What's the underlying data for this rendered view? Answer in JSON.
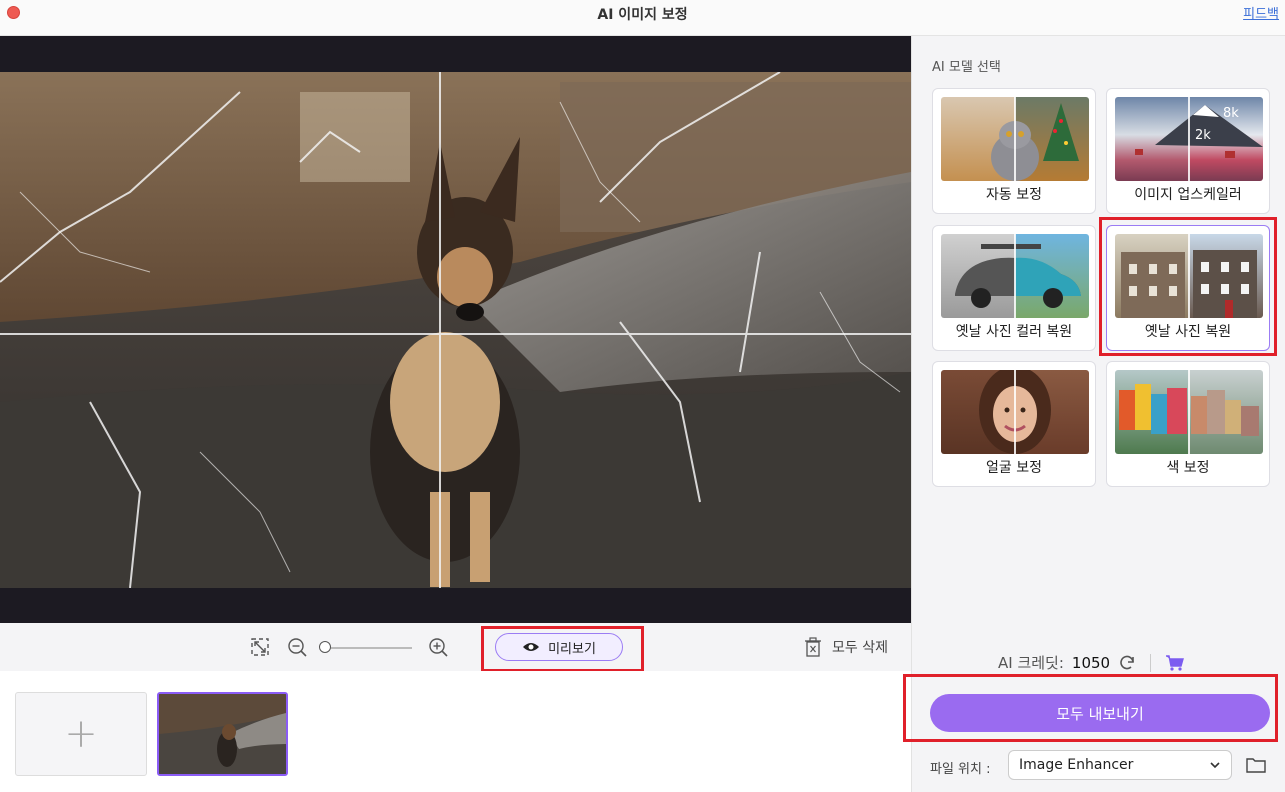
{
  "window": {
    "title": "AI 이미지 보정",
    "feedback_link": "피드백"
  },
  "toolbar": {
    "fit_icon": "fit-screen-icon",
    "zoom_out_icon": "zoom-out-icon",
    "zoom_in_icon": "zoom-in-icon",
    "zoom_level_fraction": 0.0,
    "preview_label": "미리보기",
    "delete_all_label": "모두 삭제"
  },
  "thumbnails": {
    "add_icon": "plus-icon",
    "items": [
      {
        "selected": true
      }
    ]
  },
  "panel": {
    "section_title": "AI 모델 선택",
    "models": [
      {
        "label": "자동 보정",
        "selected": false
      },
      {
        "label": "이미지 업스케일러",
        "selected": false,
        "badges": [
          "8k",
          "2k"
        ]
      },
      {
        "label": "옛날 사진 컬러 복원",
        "selected": false
      },
      {
        "label": "옛날 사진 복원",
        "selected": true
      },
      {
        "label": "얼굴 보정",
        "selected": false
      },
      {
        "label": "색 보정",
        "selected": false
      }
    ],
    "credits_label": "AI 크레딧:",
    "credits_value": "1050",
    "export_label": "모두 내보내기",
    "location_label": "파일 위치 :",
    "location_value": "Image Enhancer"
  },
  "colors": {
    "accent": "#9a6bf0",
    "highlight": "#e0202a"
  }
}
